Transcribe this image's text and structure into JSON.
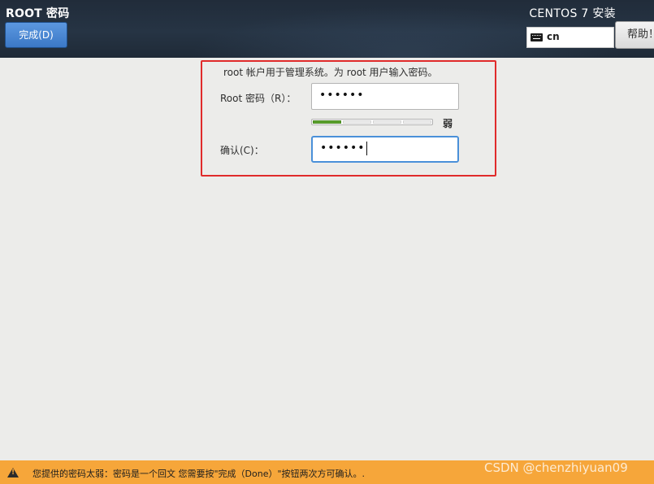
{
  "header": {
    "title": "ROOT 密码",
    "done_button_label": "完成(D)",
    "product_title": "CENTOS 7 安装",
    "keyboard_layout": "cn",
    "help_button_label": "帮助！"
  },
  "form": {
    "info_text": "root 帐户用于管理系统。为 root 用户输入密码。",
    "password_label": "Root 密码（R）：",
    "password_value": "••••••",
    "strength": {
      "label": "弱",
      "level": 1,
      "segments": 4,
      "color": "#5aa02c"
    },
    "confirm_label": "确认(C)：",
    "confirm_value": "••••••"
  },
  "status_bar": {
    "message": "您提供的密码太弱：密码是一个回文 您需要按\"完成（Done）\"按钮两次方可确认。.",
    "color": "#f6a63a",
    "icon": "warning-icon"
  },
  "watermark": "CSDN @chenzhiyuan09"
}
